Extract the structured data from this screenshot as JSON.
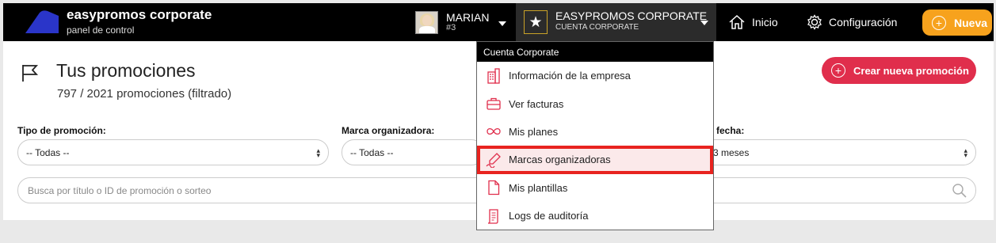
{
  "brand": {
    "title": "easypromos corporate",
    "subtitle": "panel de control"
  },
  "user": {
    "name": "MARIAN",
    "number": "#3"
  },
  "account": {
    "title": "EASYPROMOS CORPORATE",
    "subtitle": "CUENTA CORPORATE"
  },
  "nav": {
    "home": "Inicio",
    "settings": "Configuración",
    "new": "Nueva"
  },
  "page": {
    "title": "Tus promociones",
    "count": "797 / 2021 promociones (filtrado)",
    "create_button": "Crear nueva promoción"
  },
  "filters": {
    "type_label": "Tipo de promoción:",
    "type_value": "-- Todas --",
    "brand_label": "Marca organizadora:",
    "brand_value": "-- Todas --",
    "date_label": "fecha:",
    "date_value": "3 meses"
  },
  "search": {
    "placeholder": "Busca por título o ID de promoción o sorteo"
  },
  "dropdown": {
    "header": "Cuenta Corporate",
    "items": [
      {
        "label": "Información de la empresa",
        "icon": "building-icon"
      },
      {
        "label": "Ver facturas",
        "icon": "briefcase-icon"
      },
      {
        "label": "Mis planes",
        "icon": "infinity-icon"
      },
      {
        "label": "Marcas organizadoras",
        "icon": "signature-icon"
      },
      {
        "label": "Mis plantillas",
        "icon": "document-icon"
      },
      {
        "label": "Logs de auditoría",
        "icon": "log-icon"
      }
    ]
  },
  "colors": {
    "accent": "#e02e4c",
    "orange": "#f7a21d",
    "highlight": "#e8231f",
    "logo": "#2a35c9"
  }
}
